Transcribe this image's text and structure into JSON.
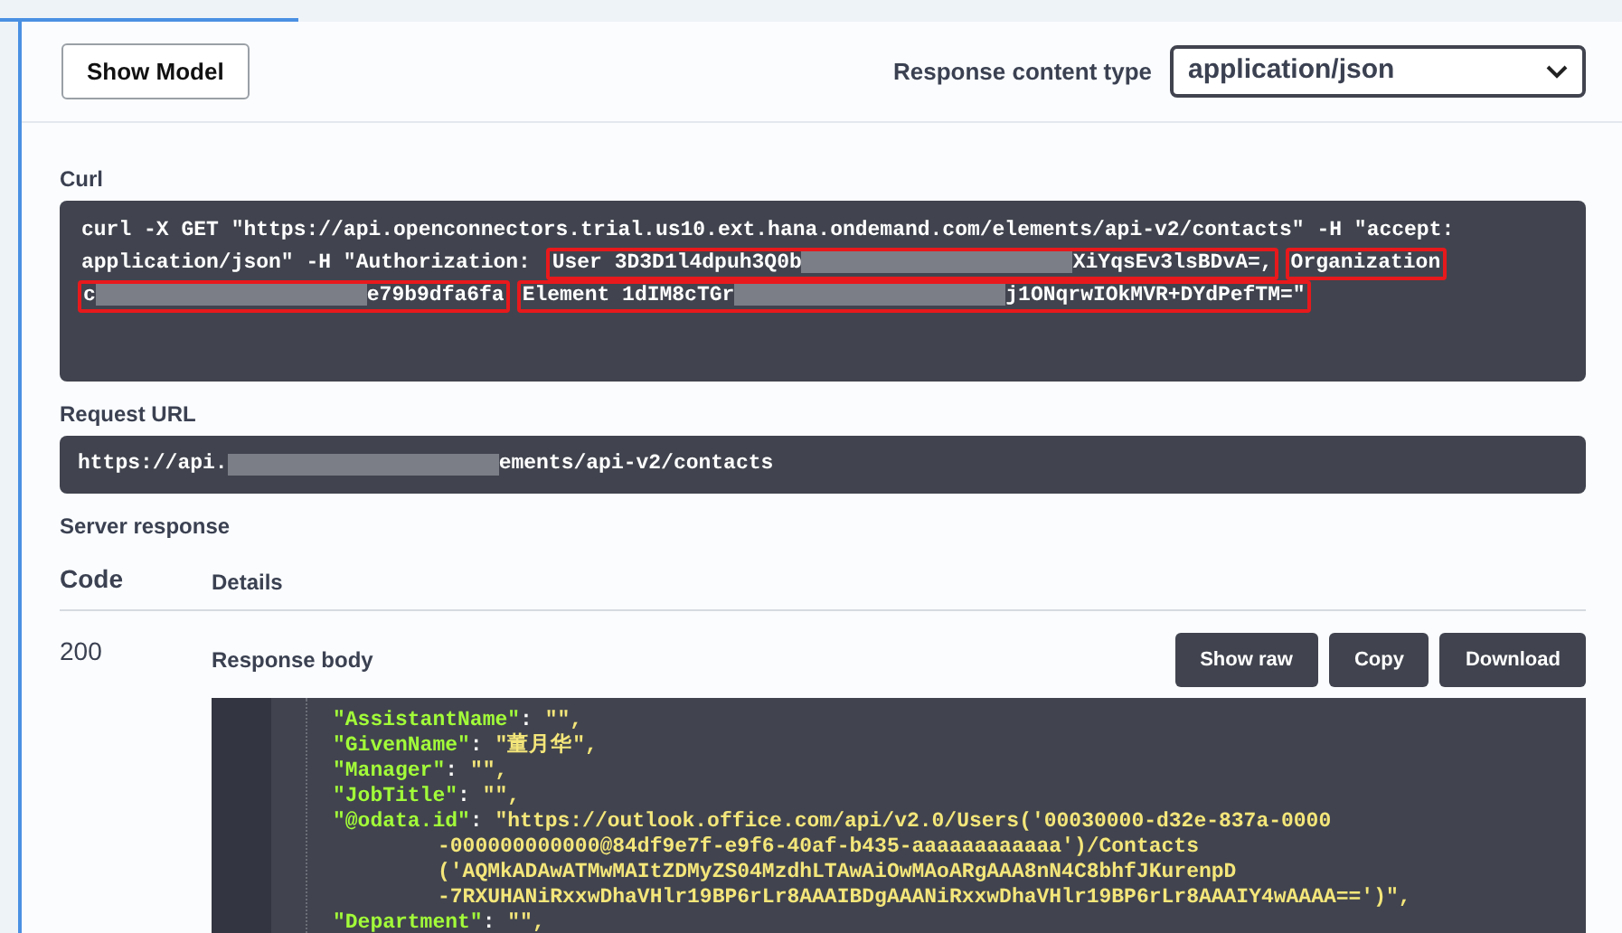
{
  "top_button": "Show Model",
  "response_content_type": {
    "label": "Response content type",
    "value": "application/json"
  },
  "curl": {
    "label": "Curl",
    "lines": [
      [
        {
          "highlighted": false,
          "parts": [
            {
              "kind": "text",
              "text": "curl -X GET \"https://api.openconnectors.trial.us10.ext.hana.ondemand.com/elements/api-v2/contacts\" -H \"accept:"
            }
          ]
        }
      ],
      [
        {
          "highlighted": false,
          "parts": [
            {
              "kind": "text",
              "text": "application/json\" -H \"Authorization: "
            }
          ]
        },
        {
          "highlighted": true,
          "parts": [
            {
              "kind": "text",
              "text": "User 3D3D1l4dpuh3Q0b"
            },
            {
              "kind": "redacted"
            },
            {
              "kind": "text",
              "text": "XiYqsEv3lsBDvA=,"
            }
          ]
        },
        {
          "highlighted": true,
          "parts": [
            {
              "kind": "text",
              "text": "Organization"
            }
          ]
        }
      ],
      [
        {
          "highlighted": true,
          "parts": [
            {
              "kind": "text",
              "text": "c"
            },
            {
              "kind": "redacted"
            },
            {
              "kind": "text",
              "text": "e79b9dfa6fa"
            }
          ]
        },
        {
          "highlighted": true,
          "parts": [
            {
              "kind": "text",
              "text": "Element 1dIM8cTGr"
            },
            {
              "kind": "redacted"
            },
            {
              "kind": "text",
              "text": "j1ONqrwIOkMVR+DYdPefTM=\""
            }
          ]
        }
      ]
    ]
  },
  "request_url": {
    "label": "Request URL",
    "parts": [
      {
        "kind": "text",
        "text": "https://api."
      },
      {
        "kind": "redacted"
      },
      {
        "kind": "text",
        "text": "ements/api-v2/contacts"
      }
    ]
  },
  "server_response": {
    "label": "Server response",
    "columns": [
      "Code",
      "Details"
    ],
    "code": "200",
    "details_label": "Response body",
    "buttons": [
      "Show raw",
      "Copy",
      "Download"
    ],
    "body_lines": [
      {
        "key": "\"AssistantName\"",
        "sep": ":",
        "value": "\"\","
      },
      {
        "key": "\"GivenName\"",
        "sep": ":",
        "value": "\"董月华\","
      },
      {
        "key": "\"Manager\"",
        "sep": ":",
        "value": "\"\","
      },
      {
        "key": "\"JobTitle\"",
        "sep": ":",
        "value": "\"\","
      },
      {
        "key": "\"@odata.id\"",
        "sep": ":",
        "value": "\"https://outlook.office.com/api/v2.0/Users('00030000-d32e-837a-0000",
        "continuation": [
          "-000000000000@84df9e7f-e9f6-40af-b435-aaaaaaaaaaaa')/Contacts",
          "('AQMkADAwATMwMAItZDMyZS04MzdhLTAwAiOwMAoARgAAA8nN4C8bhfJKurenpD",
          "-7RXUHANiRxxwDhaVHlr19BP6rLr8AAAIBDgAAANiRxxwDhaVHlr19BP6rLr8AAAIY4wAAAA==')\","
        ]
      },
      {
        "key": "\"Department\"",
        "sep": ":",
        "value": "\"\","
      }
    ]
  }
}
